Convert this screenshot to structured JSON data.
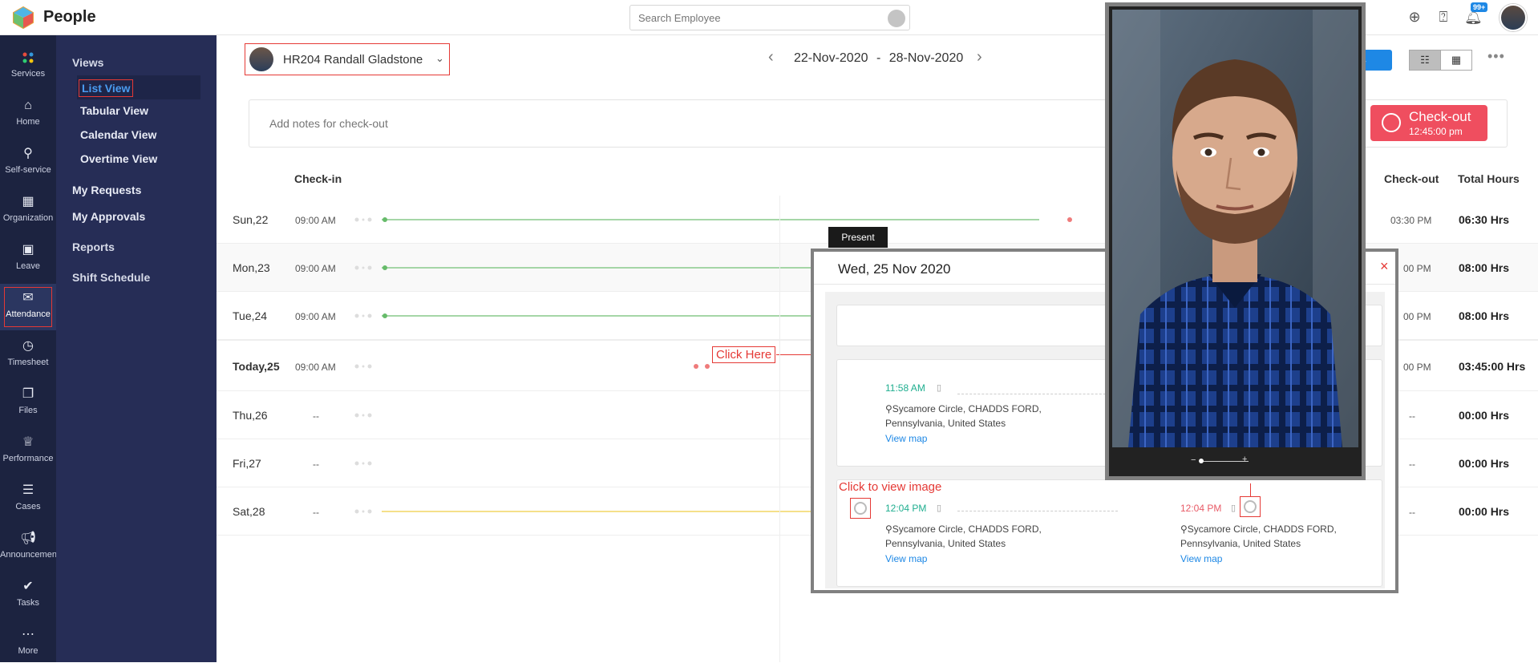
{
  "app": {
    "title": "People"
  },
  "search": {
    "placeholder": "Search Employee"
  },
  "notifications": {
    "badge": "99+"
  },
  "rail": {
    "items": [
      {
        "label": "Services",
        "icon": "services-icon"
      },
      {
        "label": "Home",
        "icon": "home-icon"
      },
      {
        "label": "Self-service",
        "icon": "user-icon"
      },
      {
        "label": "Organization",
        "icon": "building-icon"
      },
      {
        "label": "Leave",
        "icon": "calendar-icon"
      },
      {
        "label": "Attendance",
        "icon": "attendance-icon"
      },
      {
        "label": "Timesheet",
        "icon": "clock-icon"
      },
      {
        "label": "Files",
        "icon": "files-icon"
      },
      {
        "label": "Performance",
        "icon": "trophy-icon"
      },
      {
        "label": "Cases",
        "icon": "cases-icon"
      },
      {
        "label": "Announcement",
        "icon": "megaphone-icon"
      },
      {
        "label": "Tasks",
        "icon": "tasks-icon"
      },
      {
        "label": "More",
        "icon": "more-icon"
      }
    ]
  },
  "submenu": {
    "views_heading": "Views",
    "views": [
      "List View",
      "Tabular View",
      "Calendar View",
      "Overtime View"
    ],
    "my_requests": "My Requests",
    "my_approvals": "My Approvals",
    "reports": "Reports",
    "shift_schedule": "Shift Schedule"
  },
  "header": {
    "employee": "HR204 Randall Gladstone",
    "date_start": "22-Nov-2020",
    "date_sep": "-",
    "date_end": "28-Nov-2020"
  },
  "notes": {
    "placeholder": "Add notes for check-out"
  },
  "checkout": {
    "label": "Check-out",
    "time": "12:45:00 pm"
  },
  "columns": {
    "checkin": "Check-in",
    "checkout": "Check-out",
    "total": "Total Hours"
  },
  "rows": [
    {
      "day": "Sun,22",
      "checkin": "09:00 AM",
      "checkout": "03:30 PM",
      "hours": "06:30 Hrs"
    },
    {
      "day": "Mon,23",
      "checkin": "09:00 AM",
      "checkout": "00 PM",
      "hours": "08:00 Hrs"
    },
    {
      "day": "Tue,24",
      "checkin": "09:00 AM",
      "checkout": "00 PM",
      "hours": "08:00 Hrs"
    },
    {
      "day": "Today,25",
      "checkin": "09:00 AM",
      "checkout": "00 PM",
      "hours": "03:45:00 Hrs"
    },
    {
      "day": "Thu,26",
      "checkin": "--",
      "checkout": "--",
      "hours": "00:00 Hrs"
    },
    {
      "day": "Fri,27",
      "checkin": "--",
      "checkout": "--",
      "hours": "00:00 Hrs"
    },
    {
      "day": "Sat,28",
      "checkin": "--",
      "checkout": "--",
      "hours": "00:00 Hrs"
    }
  ],
  "annotations": {
    "click_here": "Click Here",
    "click_to_view": "Click to view image"
  },
  "popup": {
    "tag": "Present",
    "title": "Wed, 25 Nov 2020",
    "close": "×",
    "entry1": {
      "time": "11:58 AM",
      "addr1": "Sycamore Circle, CHADDS FORD,",
      "addr2": "Pennsylvania, United States",
      "map": "View map"
    },
    "entry2_in": {
      "time": "12:04 PM",
      "addr1": "Sycamore Circle, CHADDS FORD,",
      "addr2": "Pennsylvania, United States",
      "map": "View map"
    },
    "entry2_out": {
      "time": "12:04 PM",
      "addr1": "Sycamore Circle, CHADDS FORD,",
      "addr2": "Pennsylvania, United States",
      "map": "View map"
    }
  },
  "colors": {
    "accent": "#1e88e5",
    "danger": "#ef4e5f",
    "present_line": "#a5d6a7",
    "weekend_line": "#f5e08a",
    "rail_bg": "#1c2340",
    "submenu_bg": "#262d56"
  }
}
